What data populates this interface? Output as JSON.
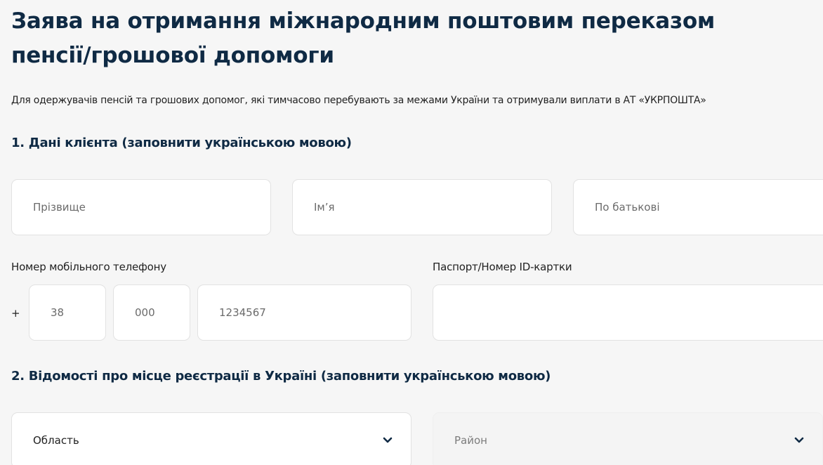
{
  "header": {
    "title": "Заява на отримання міжнародним поштовим переказом пенсії/грошової допомоги",
    "subtitle": "Для одержувачів пенсій та грошових допомог, які тимчасово перебувають за межами України та отримували виплати в АТ «УКРПОШТА»"
  },
  "section1": {
    "title": "1. Дані клієнта (заповнити українською мовою)",
    "surname_placeholder": "Прізвище",
    "name_placeholder": "Ім’я",
    "patronymic_placeholder": "По батькові",
    "phone_label": "Номер мобільного телефону",
    "phone_plus": "+",
    "phone_country_placeholder": "38",
    "phone_code_placeholder": "000",
    "phone_number_placeholder": "1234567",
    "passport_label": "Паспорт/Номер ID-картки",
    "passport_value": ""
  },
  "section2": {
    "title": "2. Відомості про місце реєстрації в Україні (заповнити українською мовою)",
    "region_value": "Область",
    "district_value": "Район"
  },
  "icons": {
    "dropdown": "chevron-down-icon"
  },
  "colors": {
    "heading": "#0f2a44",
    "background": "#f6f6f6",
    "field_bg": "#ffffff",
    "field_border": "#e2e2e2"
  }
}
